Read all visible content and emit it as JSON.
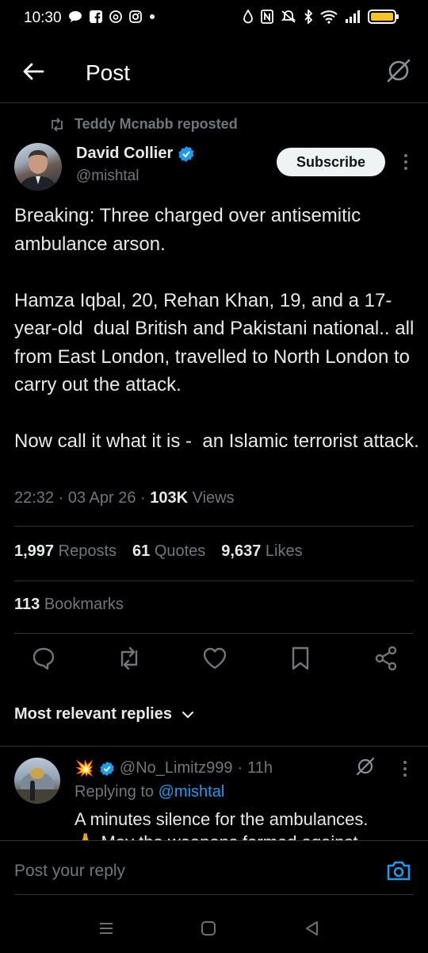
{
  "status_bar": {
    "time": "10:30"
  },
  "header": {
    "title": "Post"
  },
  "post": {
    "reposted_by": "Teddy Mcnabb reposted",
    "author_name": "David Collier",
    "author_handle": "@mishtal",
    "subscribe_label": "Subscribe",
    "text": "Breaking: Three charged over antisemitic ambulance arson.\n\nHamza Iqbal, 20, Rehan Khan, 19, and a 17-year-old  dual British and Pakistani national.. all from East London, travelled to North London to carry out the attack.\n\nNow call it what it is -  an Islamic terrorist attack.",
    "time": "22:32",
    "date": "03 Apr 26",
    "views_count": "103K",
    "views_label": "Views",
    "reposts_count": "1,997",
    "reposts_label": "Reposts",
    "quotes_count": "61",
    "quotes_label": "Quotes",
    "likes_count": "9,637",
    "likes_label": "Likes",
    "bookmarks_count": "113",
    "bookmarks_label": "Bookmarks"
  },
  "replies_filter": {
    "label": "Most relevant replies"
  },
  "reply": {
    "emoji": "💥",
    "handle": "@No_Limitz999",
    "time": "11h",
    "replying_prefix": "Replying to",
    "replying_to": "@mishtal",
    "text": "A minutes silence for the ambulances.",
    "text_partial": "🙏 May the weapons formed against"
  },
  "composer": {
    "placeholder": "Post your reply"
  },
  "colors": {
    "accent": "#1d9bf0",
    "background": "#000000",
    "muted": "#71767b",
    "text": "#e7e9ea",
    "battery": "#f6c325"
  }
}
